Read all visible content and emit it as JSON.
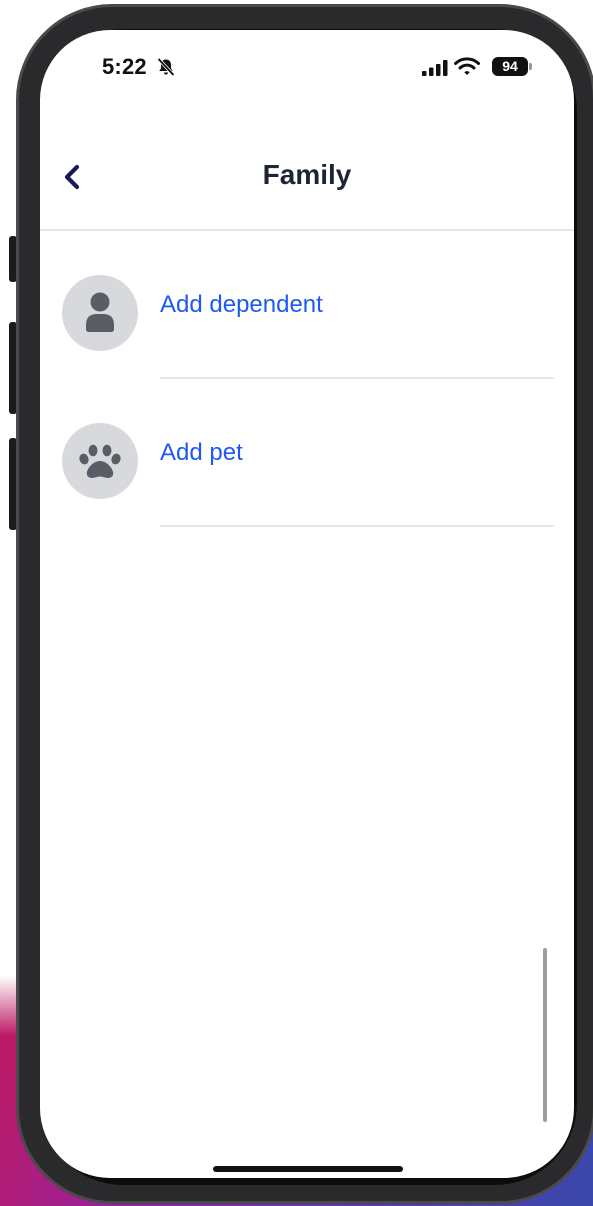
{
  "status_bar": {
    "time": "5:22",
    "silent_icon": "bell-slash-icon",
    "signal_icon": "cellular-signal-icon",
    "wifi_icon": "wifi-icon",
    "battery_level": "94"
  },
  "header": {
    "back_icon": "chevron-left-icon",
    "title": "Family"
  },
  "list": {
    "items": [
      {
        "label": "Add dependent",
        "icon": "person-icon"
      },
      {
        "label": "Add pet",
        "icon": "paw-icon"
      }
    ]
  },
  "colors": {
    "link": "#1f5af0",
    "title": "#1d2433",
    "back_chevron": "#17195a",
    "avatar_bg": "#d8d9dd",
    "avatar_glyph": "#5a5d66",
    "divider": "#e6e6e8"
  }
}
